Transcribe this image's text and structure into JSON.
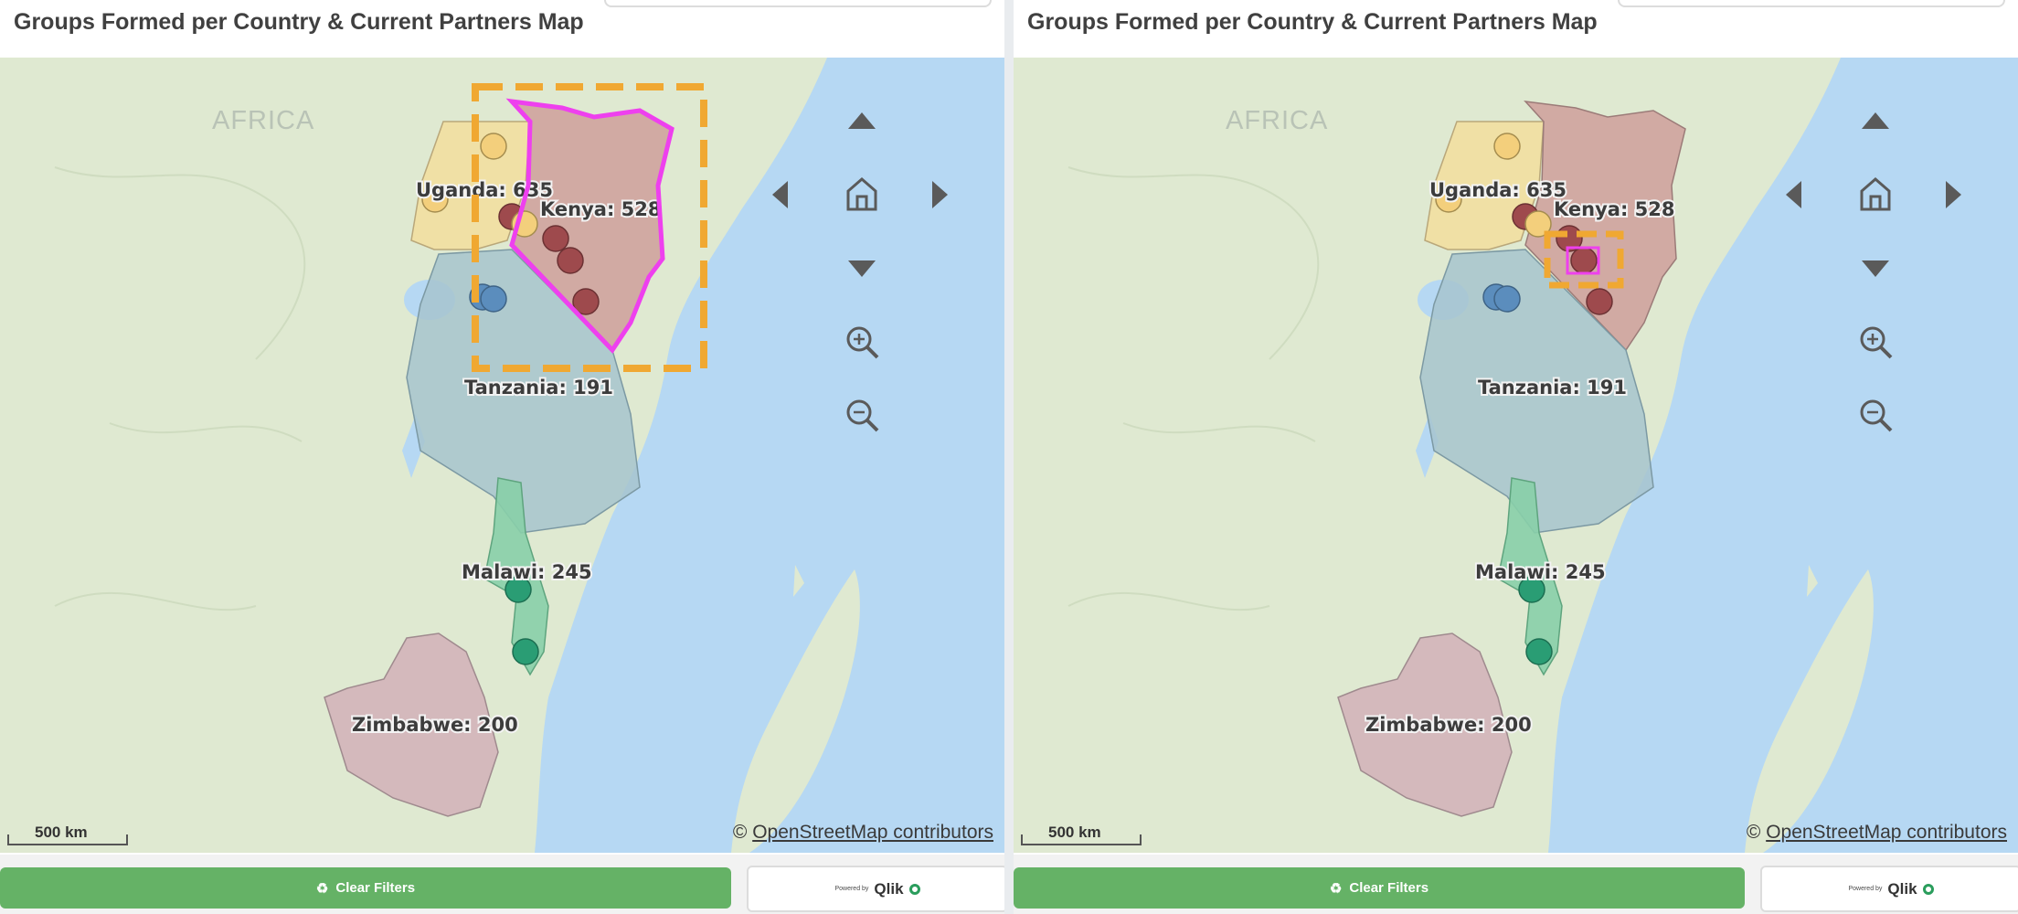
{
  "panels": [
    {
      "id": "left",
      "title": "Groups Formed per Country & Current Partners Map",
      "region_label": "AFRICA",
      "countries": [
        {
          "name": "Uganda",
          "label": "Uganda: 635",
          "value": 635,
          "color": "#f3de9d"
        },
        {
          "name": "Kenya",
          "label": "Kenya: 528",
          "value": 528,
          "color": "#cf9f9b"
        },
        {
          "name": "Tanzania",
          "label": "Tanzania: 191",
          "value": 191,
          "color": "#a7c4ce"
        },
        {
          "name": "Malawi",
          "label": "Malawi: 245",
          "value": 245,
          "color": "#88cfa8"
        },
        {
          "name": "Zimbabwe",
          "label": "Zimbabwe: 200",
          "value": 200,
          "color": "#d3b4b9"
        }
      ],
      "attribution": {
        "prefix": "©",
        "text": "OpenStreetMap contributors"
      },
      "scale": "500 km",
      "annotation": "selection around Kenya"
    },
    {
      "id": "right",
      "title": "Groups Formed per Country & Current Partners Map",
      "region_label": "AFRICA",
      "countries": [
        {
          "name": "Uganda",
          "label": "Uganda: 635",
          "value": 635
        },
        {
          "name": "Kenya",
          "label": "Kenya: 528",
          "value": 528
        },
        {
          "name": "Tanzania",
          "label": "Tanzania: 191",
          "value": 191
        },
        {
          "name": "Malawi",
          "label": "Malawi: 245",
          "value": 245
        },
        {
          "name": "Zimbabwe",
          "label": "Zimbabwe: 200",
          "value": 200
        }
      ],
      "attribution": {
        "prefix": "©",
        "text": "OpenStreetMap contributors"
      },
      "scale": "500 km",
      "annotation": "selection around a Kenya partner point"
    }
  ],
  "controls": [
    "pan-up-icon",
    "pan-left-icon",
    "home-icon",
    "pan-right-icon",
    "pan-down-icon",
    "zoom-in-icon",
    "zoom-out-icon"
  ],
  "footer": {
    "clear_filters": "Clear Filters",
    "qlik_powered": "Powered by",
    "qlik_brand": "Qlik"
  },
  "colors": {
    "water": "#b6d8f3",
    "land": "#dfe9d1",
    "highlight": "#f0a832",
    "outline": "#ee40ee",
    "button": "#65b266"
  }
}
